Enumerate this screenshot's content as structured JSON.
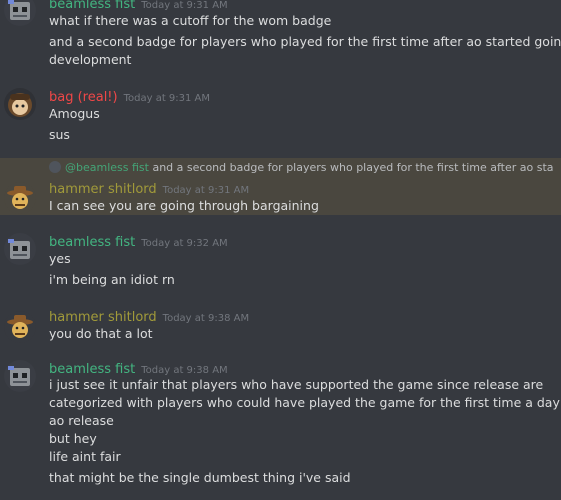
{
  "colors": {
    "beamless": "#43b581",
    "bag": "#f04747",
    "hammer": "#a19a3a"
  },
  "messages": [
    {
      "user": "beamless fist",
      "time": "Today at 9:31 AM",
      "lines": [
        "what if there was a cutoff for the wom badge",
        "and a second badge for players who played for the first time after ao started going into",
        "development"
      ]
    },
    {
      "user": "bag (real!)",
      "time": "Today at 9:31 AM",
      "lines": [
        "Amogus",
        "sus"
      ]
    },
    {
      "reply_name": "@beamless fist",
      "reply_text": "and a second badge for players who played for the first time after ao started goin…",
      "user": "hammer shitlord",
      "time": "Today at 9:31 AM",
      "lines": [
        "I can see you are going through bargaining"
      ]
    },
    {
      "user": "beamless fist",
      "time": "Today at 9:32 AM",
      "lines": [
        "yes",
        "i'm being an idiot rn"
      ]
    },
    {
      "user": "hammer shitlord",
      "time": "Today at 9:38 AM",
      "lines": [
        "you do that a lot"
      ]
    },
    {
      "user": "beamless fist",
      "time": "Today at 9:38 AM",
      "lines": [
        "i just see it unfair that players who have supported the game since release are",
        "categorized with players who could have played the game for the first time a day before",
        "ao release",
        "but hey",
        "life aint fair",
        "that might be the single dumbest thing i've said"
      ]
    }
  ]
}
